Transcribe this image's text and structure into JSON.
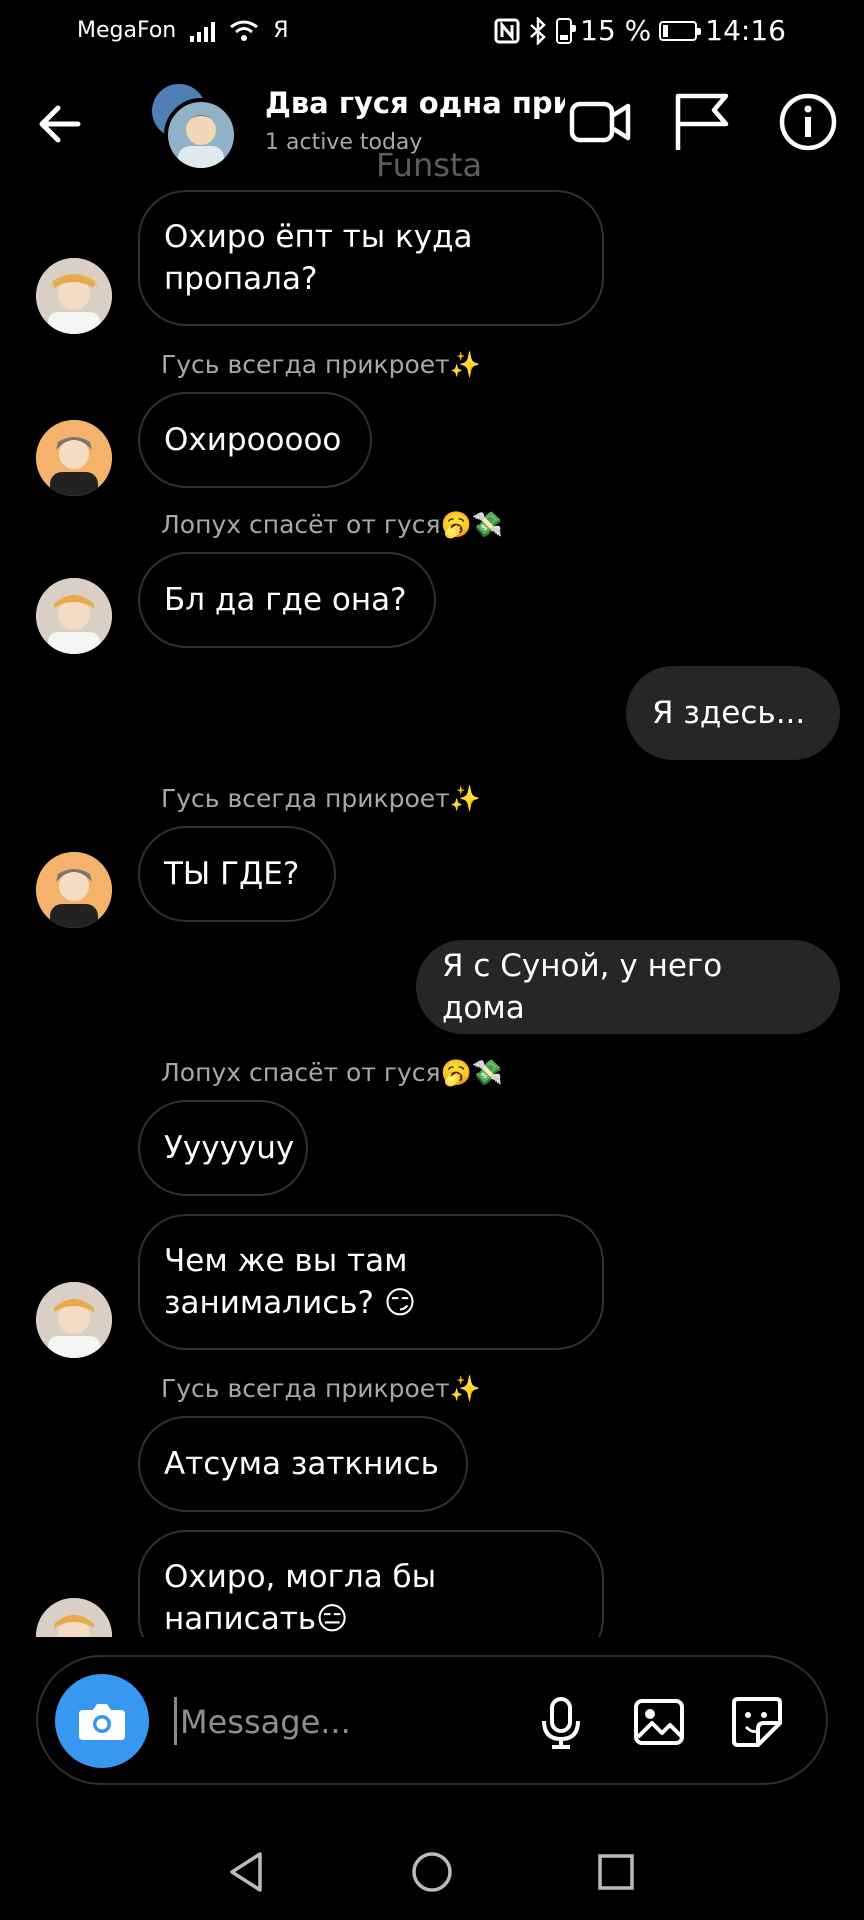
{
  "status_bar": {
    "carrier": "MegaFon",
    "carrier2": "Я",
    "battery": "15 %",
    "time": "14:16"
  },
  "header": {
    "title": "Два гуся одна при...",
    "subtitle": "1 active today",
    "watermark": "Funsta"
  },
  "messages": [
    {
      "sender": "",
      "text_lines": [
        "Охиро ёпт ты куда",
        "пропала?"
      ],
      "mine": false
    },
    {
      "sender": "Гусь всегда прикроет✨",
      "text_lines": [
        "Охирооооо"
      ],
      "mine": false
    },
    {
      "sender": "Лопух спасёт от гуся🥱💸",
      "text_lines": [
        "Бл да где она?"
      ],
      "mine": false
    },
    {
      "sender": "",
      "text_lines": [
        "Я здесь..."
      ],
      "mine": true
    },
    {
      "sender": "Гусь всегда прикроет✨",
      "text_lines": [
        "ТЫ ГДЕ?"
      ],
      "mine": false
    },
    {
      "sender": "",
      "text_lines": [
        "Я с Суной, у него дома"
      ],
      "mine": true
    },
    {
      "sender": "Лопух спасёт от гуся🥱💸",
      "text_lines": [
        "Уууууuу"
      ],
      "mine": false
    },
    {
      "sender": "",
      "text_lines": [
        "Чем же вы там",
        "занимались? 😏"
      ],
      "mine": false
    },
    {
      "sender": "Гусь всегда прикроет✨",
      "text_lines": [
        "Атсума заткнись"
      ],
      "mine": false
    },
    {
      "sender": "",
      "text_lines": [
        "Охиро,  могла бы",
        "написать😑"
      ],
      "mine": false
    }
  ],
  "composer": {
    "placeholder": "Message..."
  },
  "colors": {
    "accent": "#3897f0",
    "background": "#000000",
    "bubble_border": "#303030",
    "my_bubble": "#262626",
    "muted_text": "#a8a8a8"
  },
  "icons": [
    "back-arrow-icon",
    "video-call-icon",
    "flag-icon",
    "info-icon",
    "camera-icon",
    "microphone-icon",
    "gallery-icon",
    "sticker-icon",
    "nav-back-icon",
    "nav-home-icon",
    "nav-recents-icon"
  ]
}
